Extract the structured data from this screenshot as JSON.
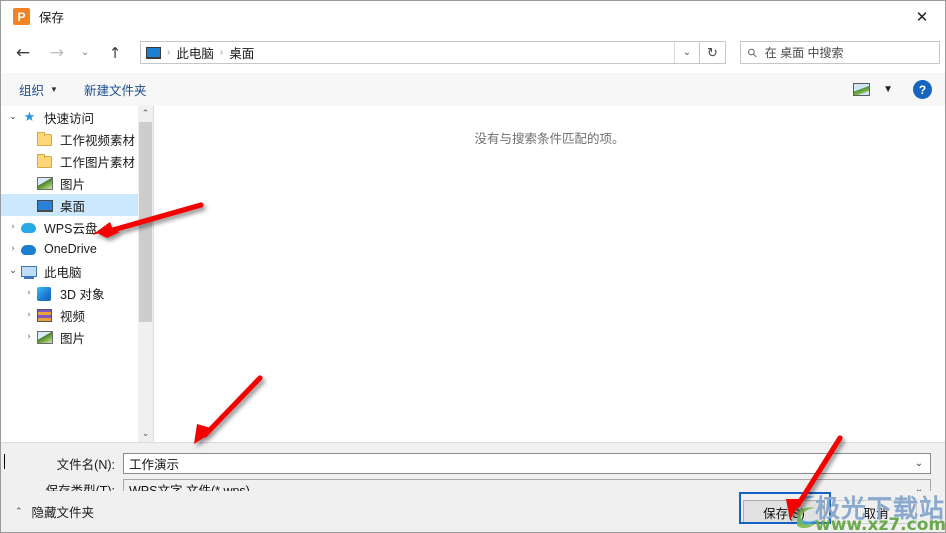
{
  "window": {
    "title": "保存",
    "app_icon_letter": "P",
    "app_icon_color": "#f08323",
    "close_label": "✕"
  },
  "nav": {
    "back_icon": "←",
    "forward_icon": "→",
    "recent_icon": "⌄",
    "up_icon": "↑",
    "refresh_icon": "↻",
    "address_dropdown_icon": "⌄",
    "breadcrumbs": [
      "此电脑",
      "桌面"
    ],
    "separator": "›"
  },
  "search": {
    "icon": "search-icon",
    "placeholder": "在 桌面 中搜索"
  },
  "toolbar": {
    "organize_label": "组织",
    "organize_caret": "▼",
    "new_folder_label": "新建文件夹",
    "view_caret": "▼",
    "help_label": "?"
  },
  "tree": [
    {
      "label": "快速访问",
      "icon": "star-icon",
      "chevron": "⌄",
      "indent": 0,
      "selected": false
    },
    {
      "label": "工作视频素材",
      "icon": "folder-icon",
      "chevron": "",
      "indent": 1,
      "selected": false
    },
    {
      "label": "工作图片素材",
      "icon": "folder-icon",
      "chevron": "",
      "indent": 1,
      "selected": false
    },
    {
      "label": "图片",
      "icon": "picture-icon",
      "chevron": "",
      "indent": 1,
      "selected": false
    },
    {
      "label": "桌面",
      "icon": "desktop-icon",
      "chevron": "",
      "indent": 1,
      "selected": true
    },
    {
      "label": "WPS云盘",
      "icon": "cloud-icon",
      "chevron": "›",
      "indent": 0,
      "selected": false
    },
    {
      "label": "OneDrive",
      "icon": "onedrive-icon",
      "chevron": "›",
      "indent": 0,
      "selected": false
    },
    {
      "label": "此电脑",
      "icon": "computer-icon",
      "chevron": "⌄",
      "indent": 0,
      "selected": false
    },
    {
      "label": "3D 对象",
      "icon": "3d-objects-icon",
      "chevron": "›",
      "indent": 1,
      "selected": false
    },
    {
      "label": "视频",
      "icon": "video-icon",
      "chevron": "›",
      "indent": 1,
      "selected": false
    },
    {
      "label": "图片",
      "icon": "picture-icon",
      "chevron": "›",
      "indent": 1,
      "selected": false
    }
  ],
  "file_list": {
    "empty_message": "没有与搜索条件匹配的项。"
  },
  "fields": {
    "filename_label": "文件名(N):",
    "filename_value": "工作演示",
    "filetype_label": "保存类型(T):",
    "filetype_value": "WPS文字 文件(*.wps)",
    "dropdown_icon": "⌄"
  },
  "footer": {
    "hide_folders_label": "隐藏文件夹",
    "hide_folders_caret": "⌃",
    "save_label": "保存(S)",
    "cancel_label": "取消",
    "save_highlight_color": "#1463c6"
  },
  "watermark": {
    "title": "极光下载站",
    "url": "www.xz7.com",
    "title_color": "#8aa9cf",
    "url_color": "#6aa84f"
  },
  "annotations": {
    "arrow_color": "#f50000",
    "arrows": [
      {
        "name": "arrow-to-desktop-tree-item"
      },
      {
        "name": "arrow-to-filename-field"
      },
      {
        "name": "arrow-to-save-button"
      }
    ]
  }
}
